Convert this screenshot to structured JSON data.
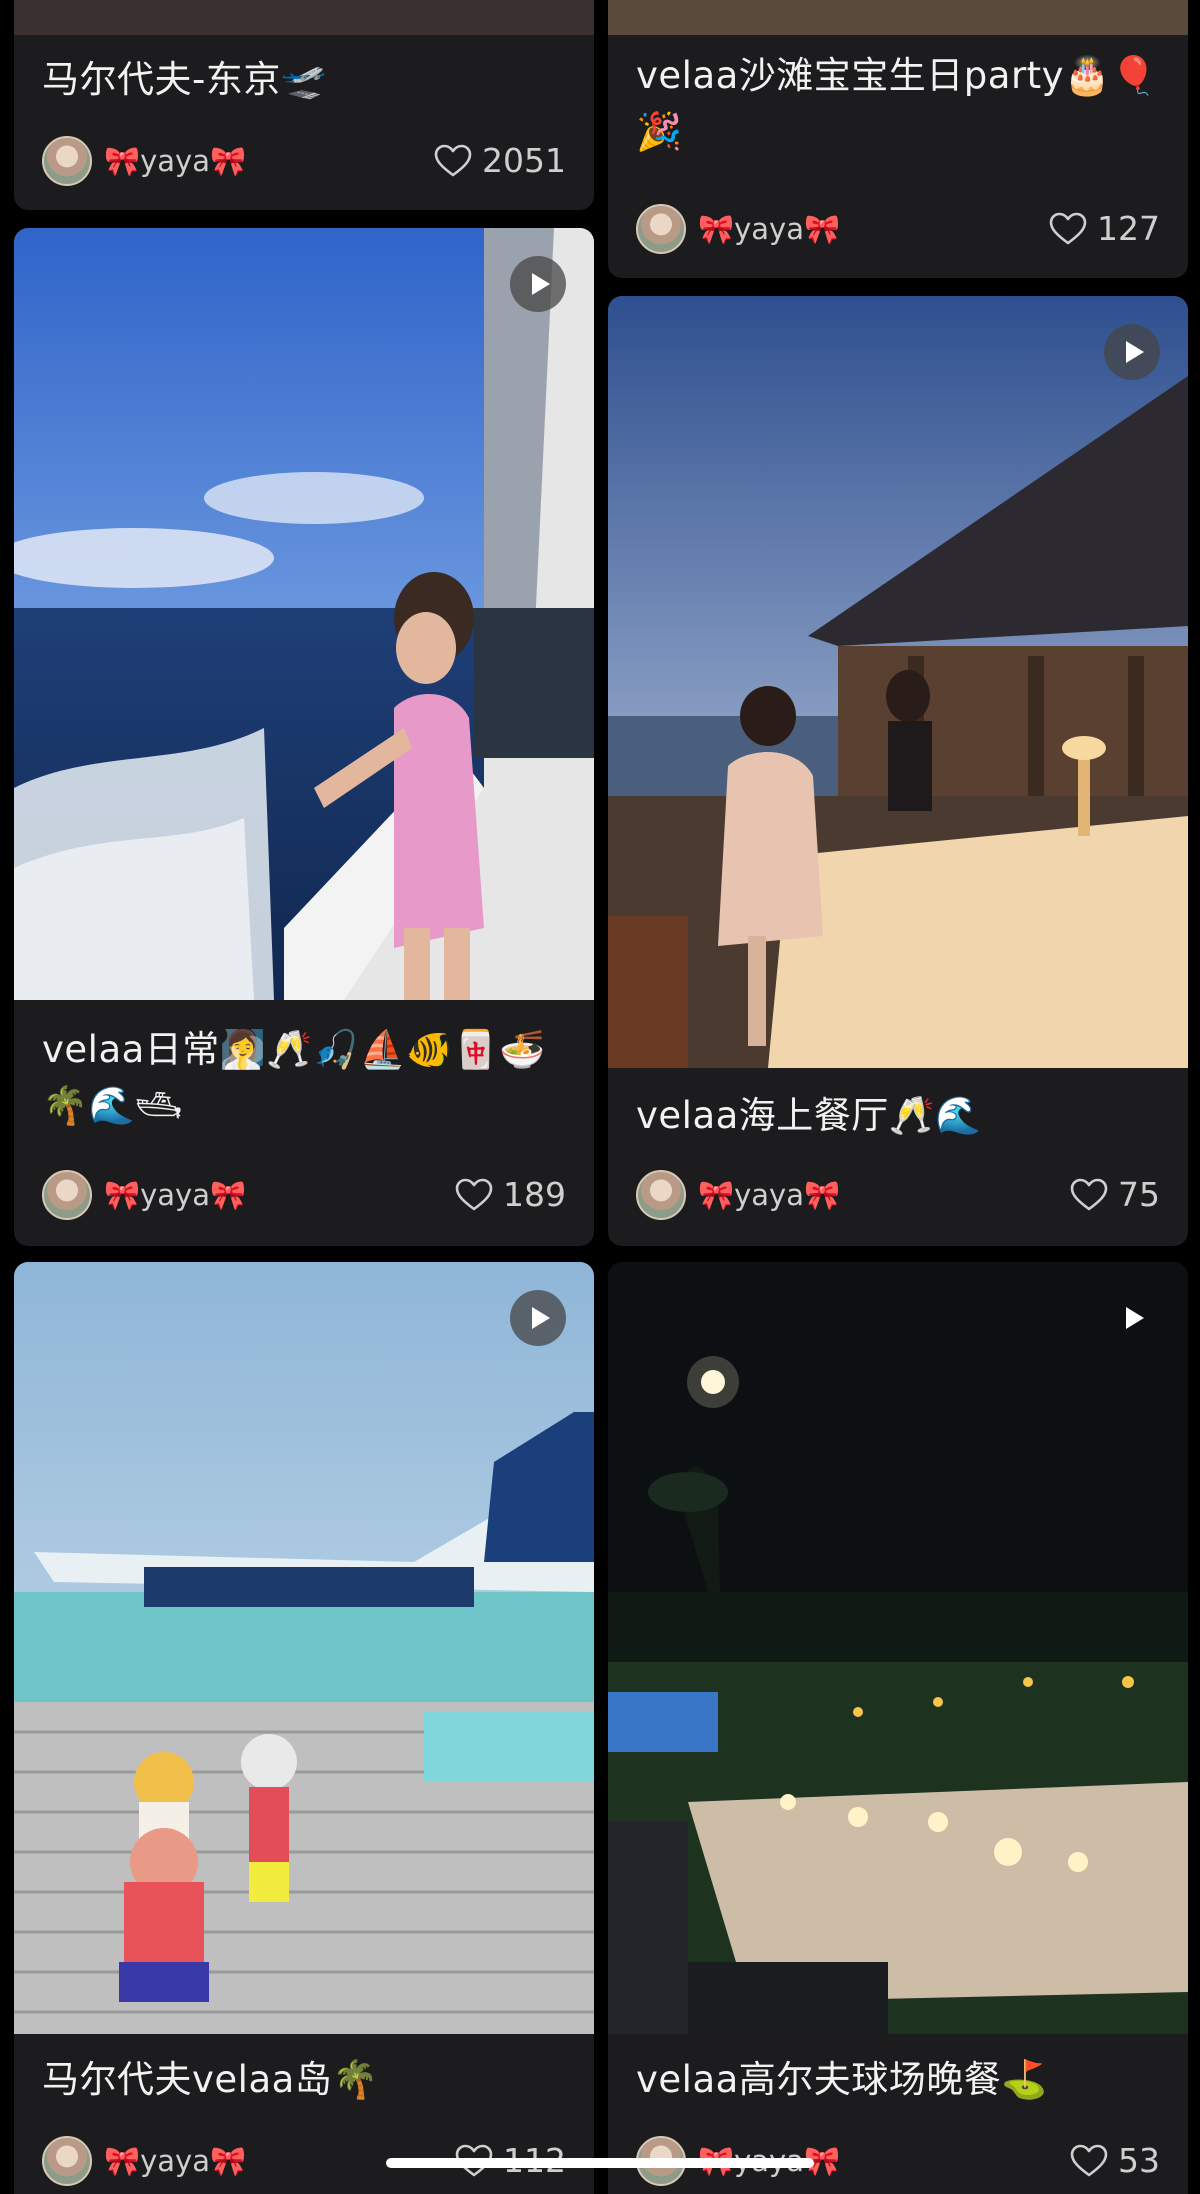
{
  "feed": {
    "left": [
      {
        "title": "马尔代夫-东京🛫",
        "author": "🎀yaya🎀",
        "likes": "2051"
      },
      {
        "title": "velaa日常🧖‍♀️🥂🎣⛵️🐠🀄️🍜🌴🌊🛥",
        "author": "🎀yaya🎀",
        "likes": "189",
        "play": "play-icon"
      },
      {
        "title": "马尔代夫velaa岛🌴",
        "author": "🎀yaya🎀",
        "likes": "112",
        "play": "play-icon"
      }
    ],
    "right": [
      {
        "title": "velaa沙滩宝宝生日party🎂🎈🎉",
        "author": "🎀yaya🎀",
        "likes": "127"
      },
      {
        "title": "velaa海上餐厅🥂🌊",
        "author": "🎀yaya🎀",
        "likes": "75",
        "play": "play-icon"
      },
      {
        "title": "velaa高尔夫球场晚餐⛳️",
        "author": "🎀yaya🎀",
        "likes": "53",
        "play": "play-icon"
      }
    ]
  },
  "icons": {
    "like": "heart-outline-icon",
    "play": "play-icon"
  },
  "colors": {
    "background": "#000000",
    "card": "#1c1c1e",
    "text": "#f2f2f2",
    "muted": "#cfcfcf"
  }
}
